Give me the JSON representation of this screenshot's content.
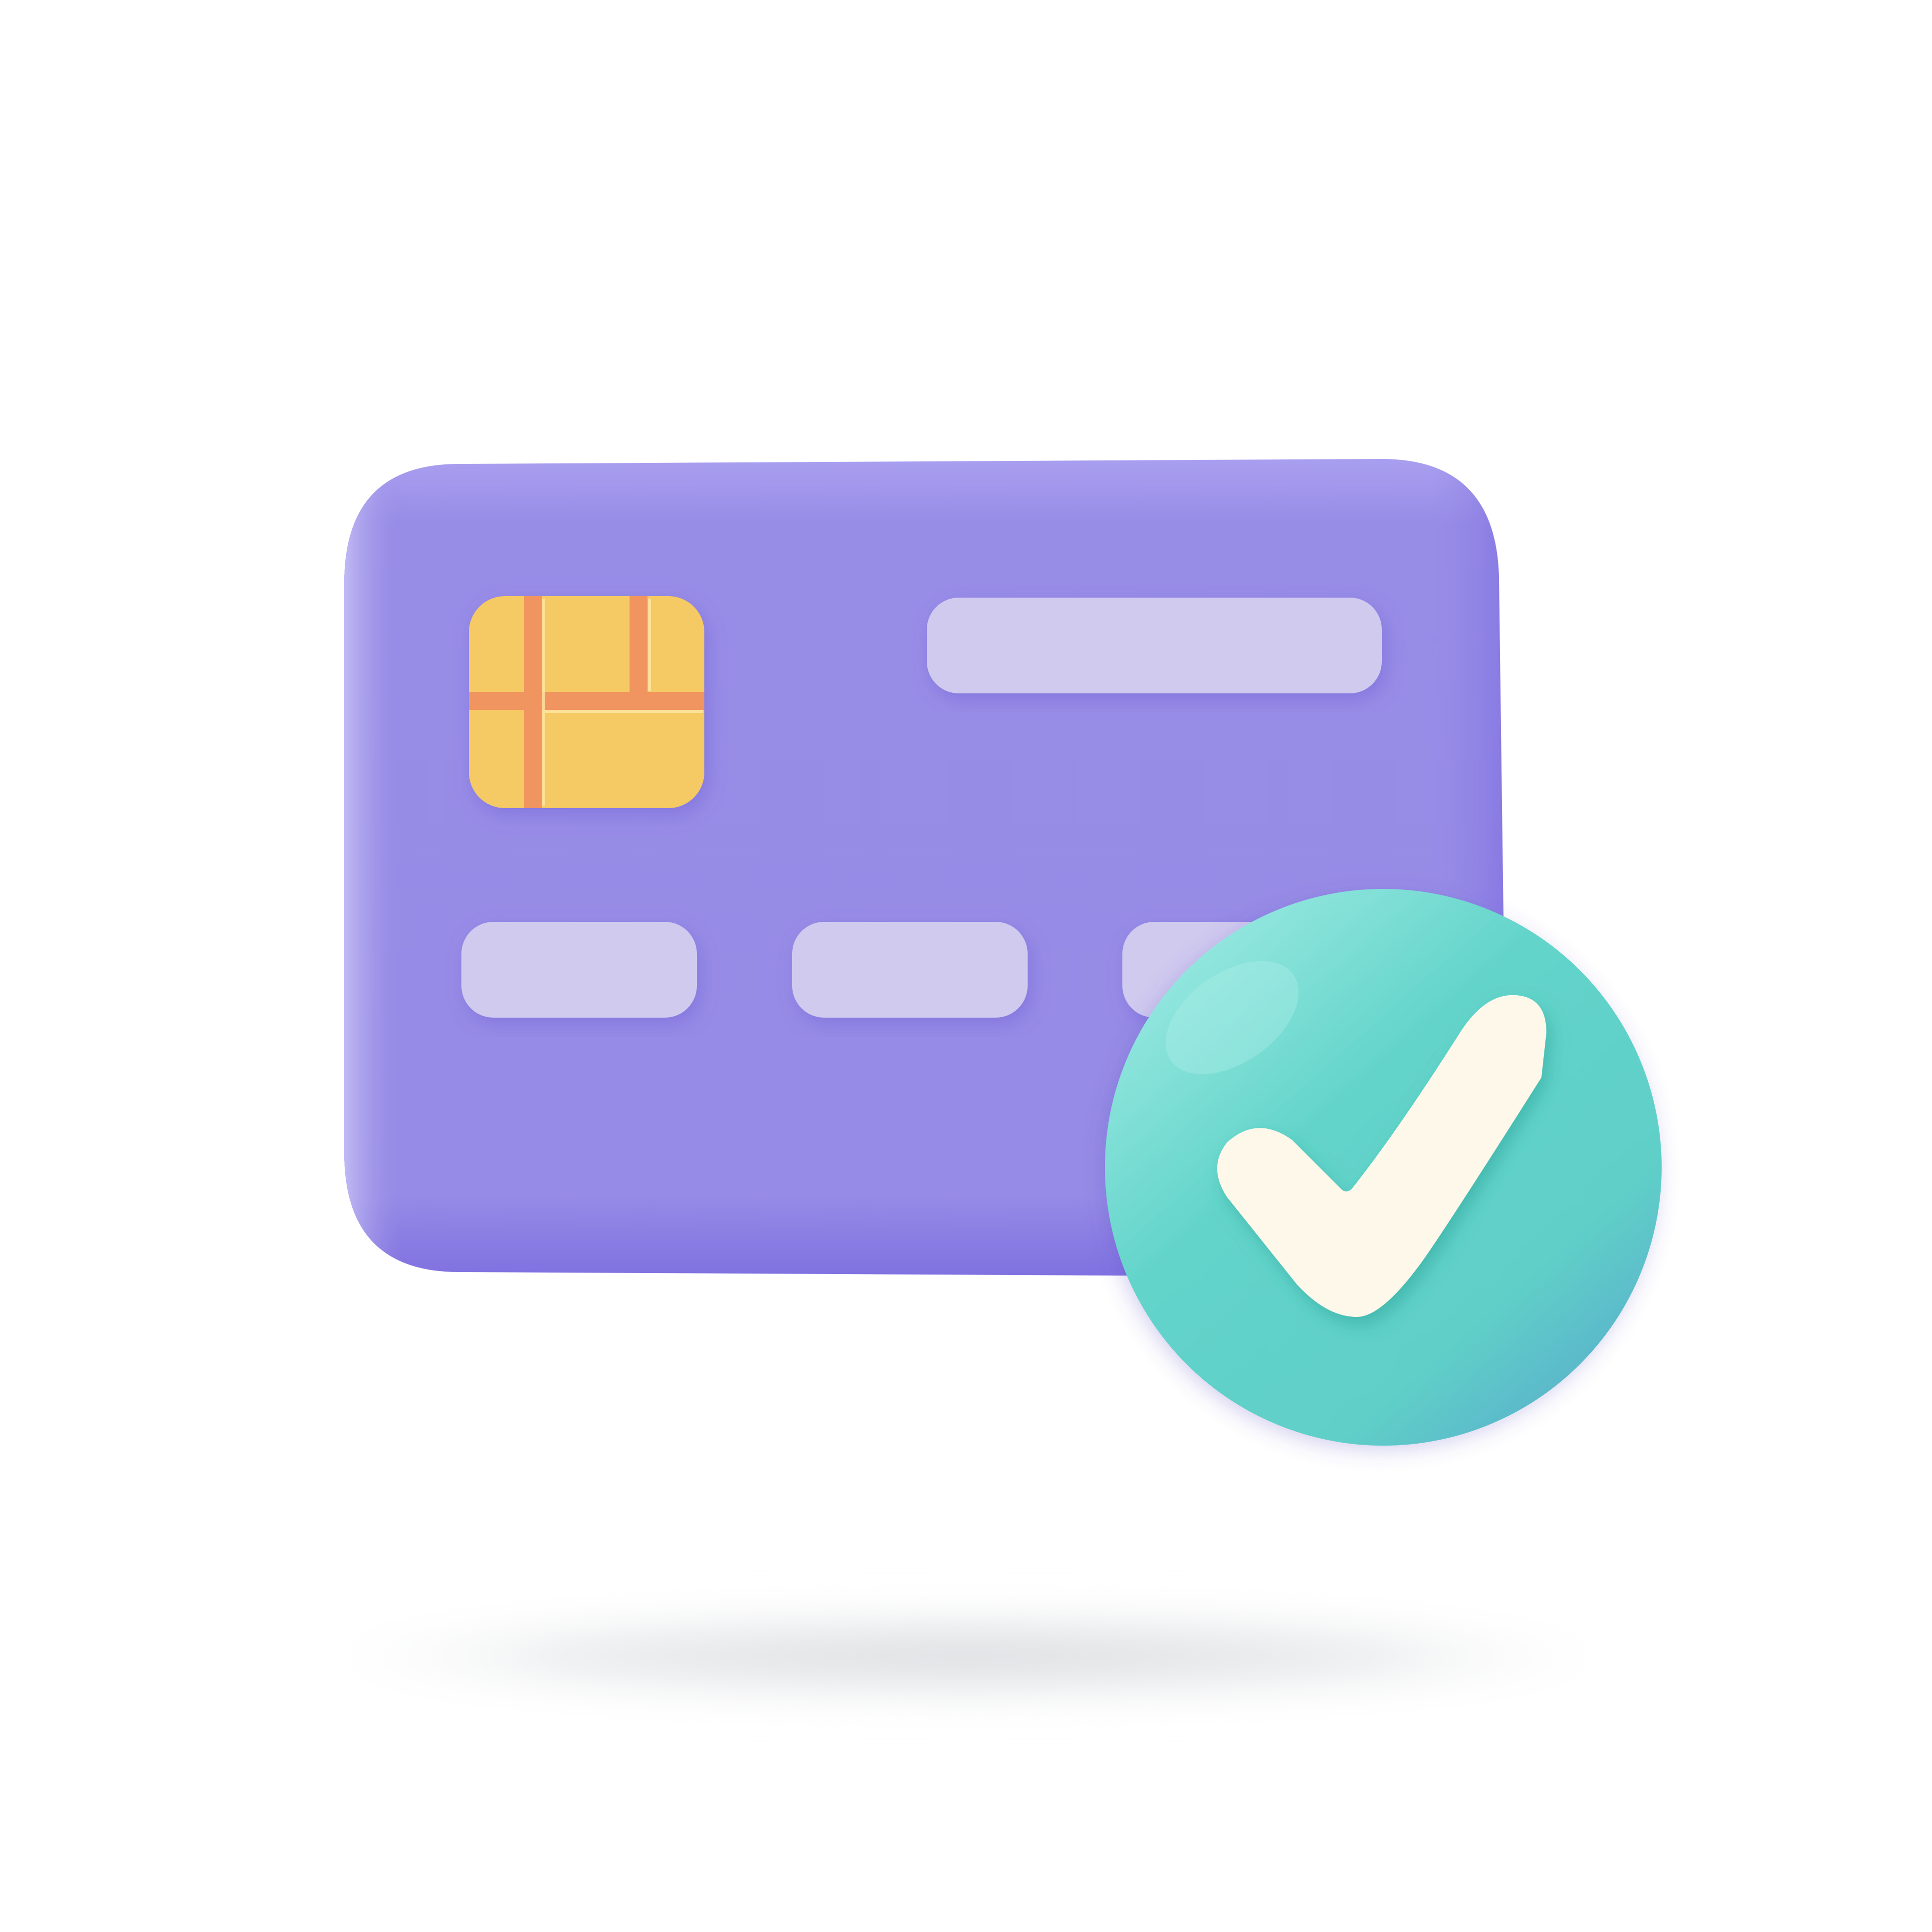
{
  "illustration": {
    "subject": "",
    "icons": [
      "credit-card-icon",
      "card-chip-icon",
      "check-badge-icon",
      "checkmark-icon"
    ]
  },
  "colors": {
    "background": "#ffffff",
    "card": "#978ce6",
    "card_light": "#b3aaef",
    "card_dark": "#7f6fe0",
    "card_field": "#d0caef",
    "chip": "#f5c963",
    "chip_line": "#f0955e",
    "badge": "#62d3c9",
    "badge_light": "#93e6df",
    "badge_dark": "#5cb3c9",
    "checkmark": "#fdf8ea",
    "floor_shadow": "#dde0e3"
  }
}
